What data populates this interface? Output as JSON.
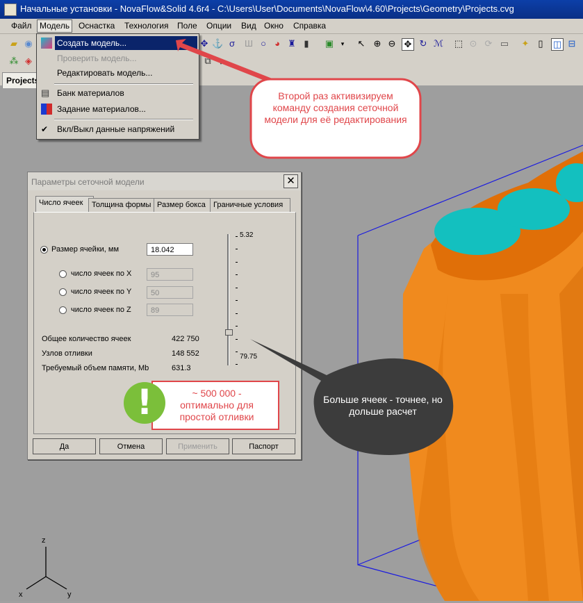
{
  "window": {
    "title": "Начальные установки - NovaFlow&Solid 4.6r4 - C:\\Users\\User\\Documents\\NovaFlow\\4.60\\Projects\\Geometry\\Projects.cvg"
  },
  "menubar": [
    "Файл",
    "Модель",
    "Оснастка",
    "Технология",
    "Поле",
    "Опции",
    "Вид",
    "Окно",
    "Справка"
  ],
  "model_menu": {
    "create": "Создать модель...",
    "check": "Проверить модель...",
    "edit": "Редактировать модель...",
    "materials_bank": "Банк материалов",
    "materials_assign": "Задание материалов...",
    "stress_toggle": "Вкл/Выкл данные напряжений"
  },
  "project_tab": "Projects",
  "dialog": {
    "title": "Параметры сеточной модели",
    "tabs": [
      "Число ячеек",
      "Толщина формы",
      "Размер бокса",
      "Граничные условия"
    ],
    "cell_size_label": "Размер ячейки, мм",
    "cell_size_value": "18.042",
    "cells_x_label": "число ячеек по X",
    "cells_x_value": "95",
    "cells_y_label": "число ячеек по Y",
    "cells_y_value": "50",
    "cells_z_label": "число ячеек по Z",
    "cells_z_value": "89",
    "total_cells_label": "Общее количество ячеек",
    "total_cells_value": "422 750",
    "casting_nodes_label": "Узлов отливки",
    "casting_nodes_value": "148 552",
    "memory_label": "Требуемый объем памяти, Mb",
    "memory_value": "631.3",
    "slider_max_label": "5.32",
    "slider_min_label": "79.75",
    "buttons": {
      "ok": "Да",
      "cancel": "Отмена",
      "apply": "Применить",
      "passport": "Паспорт"
    }
  },
  "callouts": {
    "top": "Второй раз активизируем команду создания сеточной модели для её редактирования",
    "middle": "~ 500 000 - оптимально для простой отливки",
    "bottom": "Больше ячеек - точнее, но дольше расчет",
    "exclamation": "!"
  },
  "axes": {
    "z": "z",
    "x": "x",
    "y": "y"
  },
  "colors": {
    "accent_red": "#e0464a",
    "callout_dark": "#3c3c3c",
    "casting_orange": "#f08a1e",
    "casting_cyan": "#13c0bf",
    "box_blue": "#1a1ae0",
    "green": "#7bbf3a"
  }
}
